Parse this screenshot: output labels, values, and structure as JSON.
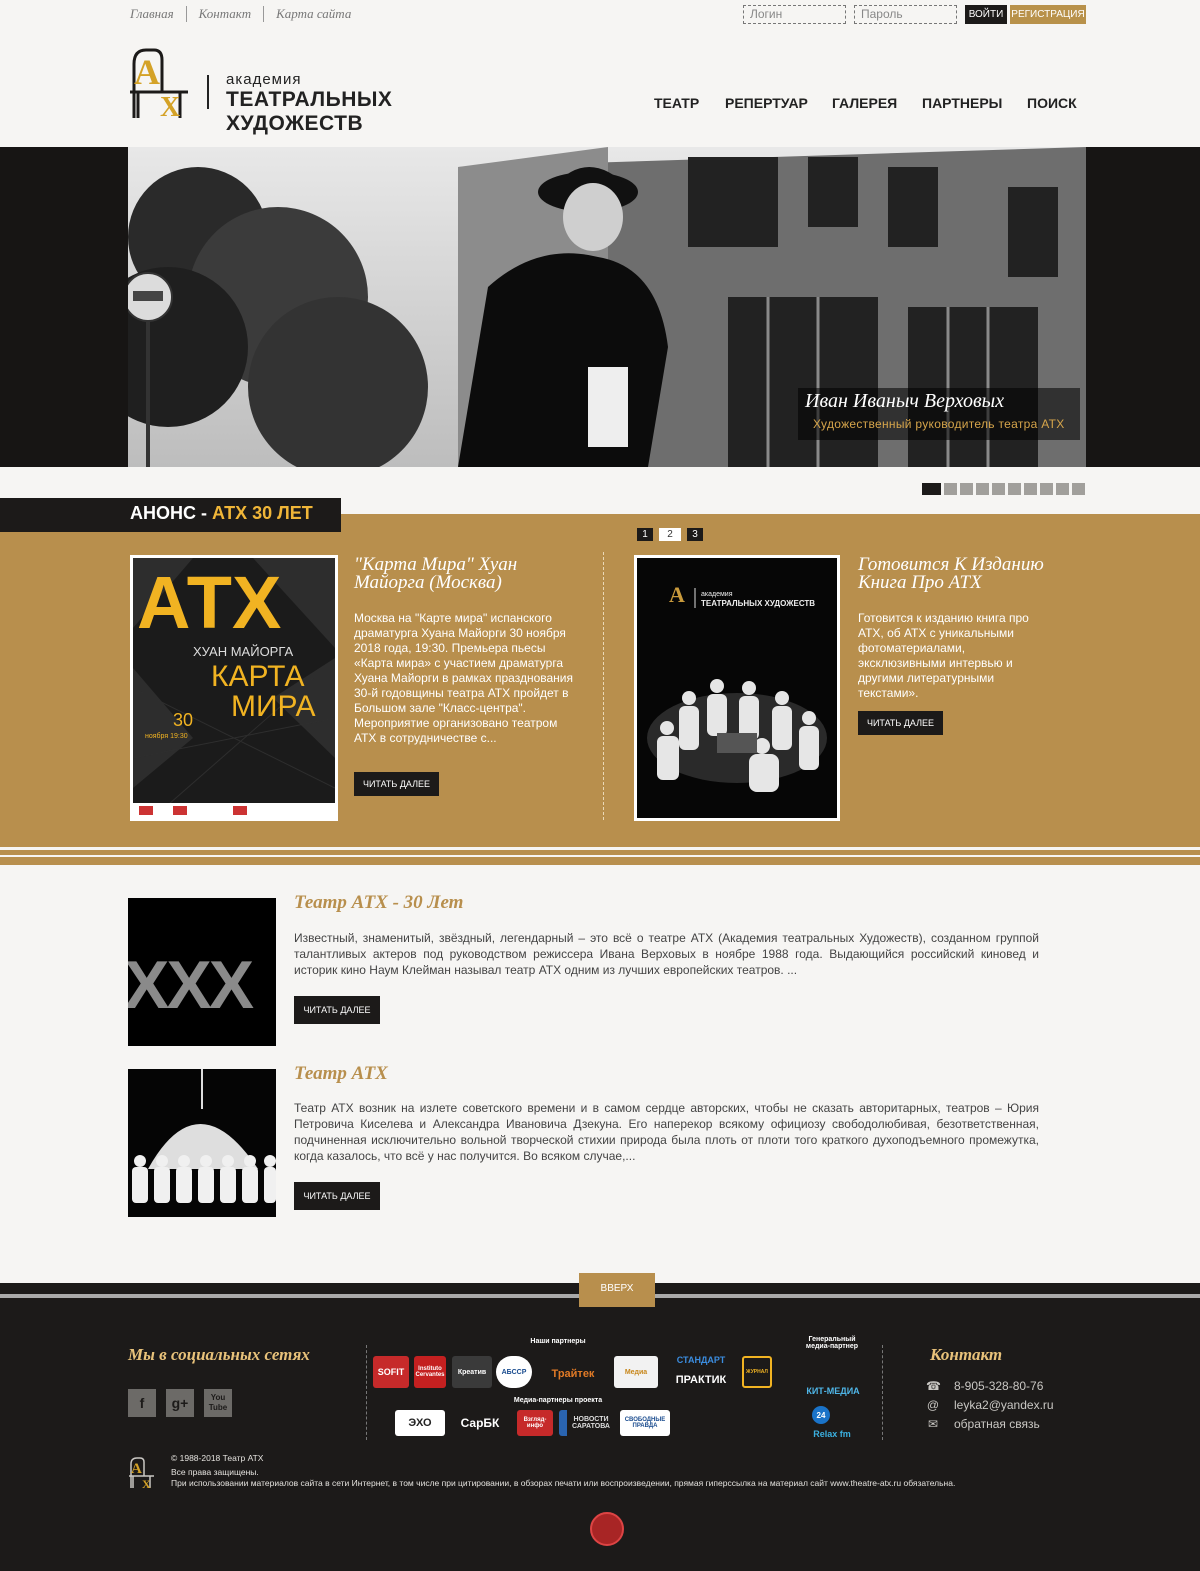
{
  "toplinks": {
    "home": "Главная",
    "contact": "Контакт",
    "sitemap": "Карта сайта"
  },
  "auth": {
    "login_placeholder": "Логин",
    "password_placeholder": "Пароль",
    "login_btn": "ВОЙТИ",
    "register_btn": "РЕГИСТРАЦИЯ"
  },
  "logo": {
    "line1": "академия",
    "line2": "ТЕАТРАЛЬНЫХ ХУДОЖЕСТВ"
  },
  "nav": [
    "ТЕАТР",
    "РЕПЕРТУАР",
    "ГАЛЕРЕЯ",
    "ПАРТНЕРЫ",
    "ПОИСК"
  ],
  "hero": {
    "name": "Иван Иваныч Верховых",
    "role": "Художественный руководитель театра АТХ",
    "slides": 10,
    "active_slide": 1
  },
  "announce": {
    "tab_prefix": "АНОНС - ",
    "tab_highlight": "АТХ 30 ЛЕТ",
    "pages": [
      "1",
      "2",
      "3"
    ],
    "active_page": "2",
    "cards": [
      {
        "title": "\"Карта Мира\" Хуан Майорга (Москва)",
        "text": "Москва на \"Карте мира\" испанского драматурга Хуана Майорги 30 ноября 2018 года, 19:30. Премьера пьесы «Карта мира» с участием драматурга Хуана Майорги в рамках празднования 30-й годовщины театра АТХ пройдет в Большом зале \"Класс-центра\". Мероприятие организовано театром АТХ в сотрудничестве с...",
        "button": "ЧИТАТЬ ДАЛЕЕ",
        "poster": {
          "big": "АТХ",
          "author": "ХУАН МАЙОРГА",
          "play": "КАРТА",
          "play2": "МИРА",
          "day": "30",
          "month": "ноября 19:30"
        }
      },
      {
        "title": "Готовится К Изданию Книга Про АТХ",
        "text": "Готовится к изданию книга про АТХ, об АТХ с уникальными фотоматериалами, эксклюзивными интервью и другими литературными текстами».",
        "button": "ЧИТАТЬ ДАЛЕЕ",
        "poster": {
          "line1": "академия",
          "line2": "ТЕАТРАЛЬНЫХ ХУДОЖЕСТВ"
        }
      }
    ]
  },
  "articles": [
    {
      "title": "Театр АТХ - 30 Лет",
      "text": "Известный, знаменитый, звёздный, легендарный – это всё о театре АТХ (Академия театральных Художеств), созданном группой талантливых актеров под руководством режиссера Ивана Верховых в ноябре 1988 года. Выдающийся российский киновед и историк кино Наум Клейман называл театр АТХ одним из лучших европейских театров. ...",
      "button": "ЧИТАТЬ ДАЛЕЕ",
      "image_text": "XXX"
    },
    {
      "title": "Театр АТХ",
      "text": "Театр АТХ возник на излете советского времени и в самом сердце авторских, чтобы не сказать авторитарных, театров – Юрия Петровича Киселева и Александра Ивановича Дзекуна. Его наперекор всякому официозу свободолюбивая, безответственная, подчиненная исключительно вольной творческой стихии природа была плоть от плоти того краткого духоподъемного промежутка, когда казалось, что всё у нас получится. Во всяком случае,...",
      "button": "ЧИТАТЬ ДАЛЕЕ"
    }
  ],
  "footer": {
    "up": "ВВЕРХ",
    "social_title": "Мы в социальных сетях",
    "social": [
      "f",
      "g+",
      "You Tube"
    ],
    "partners_title": "Наши партнеры",
    "media_title": "Медиа-партнеры проекта",
    "general_title": "Генеральный медиа-партнер",
    "partners": [
      "SOFIT",
      "Instituto Cervantes",
      "Креатив",
      "АБССР",
      "Трайтек",
      "Медиа",
      "СТАНДАРТ",
      "ПРАКТИК",
      "ЖУРНАЛ"
    ],
    "media": [
      "ЭХО",
      "СарБК",
      "Взгляд-инфо",
      "НОВОСТИ САРАТОВА",
      "СВОБОДНЫЕ ПРАВДА"
    ],
    "general": [
      "КИТ-МЕДИА",
      "24",
      "Relax fm"
    ],
    "contact_title": "Контакт",
    "phone": "8-905-328-80-76",
    "email": "leyka2@yandex.ru",
    "feedback": "обратная связь",
    "copyright": "© 1988-2018 Театр АТХ",
    "rights": "Все права защищены.",
    "notice": "При использовании материалов сайта в сети Интернет, в том числе при цитировании, в обзорах печати или воспроизведении, прямая гиперссылка на материал сайт www.theatre-atx.ru обязательна."
  }
}
